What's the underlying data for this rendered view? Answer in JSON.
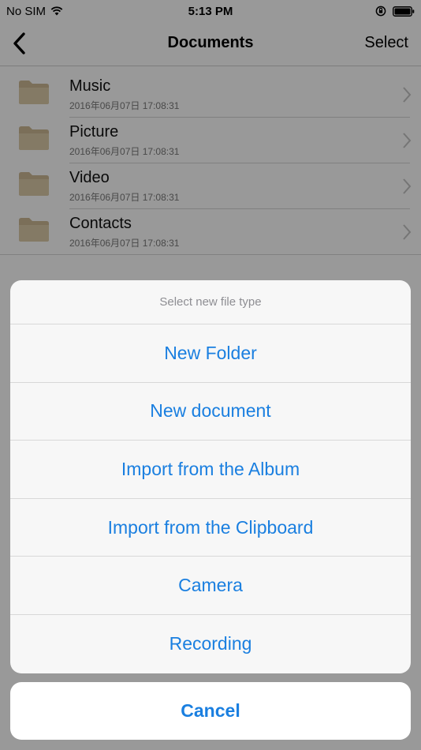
{
  "status_bar": {
    "carrier": "No SIM",
    "time": "5:13 PM"
  },
  "nav": {
    "title": "Documents",
    "select_label": "Select"
  },
  "files": [
    {
      "name": "Music",
      "date": "2016年06月07日 17:08:31"
    },
    {
      "name": "Picture",
      "date": "2016年06月07日 17:08:31"
    },
    {
      "name": "Video",
      "date": "2016年06月07日 17:08:31"
    },
    {
      "name": "Contacts",
      "date": "2016年06月07日 17:08:31"
    }
  ],
  "action_sheet": {
    "title": "Select new file type",
    "options": [
      "New Folder",
      "New document",
      "Import from the Album",
      "Import from the Clipboard",
      "Camera",
      "Recording"
    ],
    "cancel_label": "Cancel"
  },
  "colors": {
    "accent": "#1a7fe0",
    "folder": "#d9c8a6"
  }
}
